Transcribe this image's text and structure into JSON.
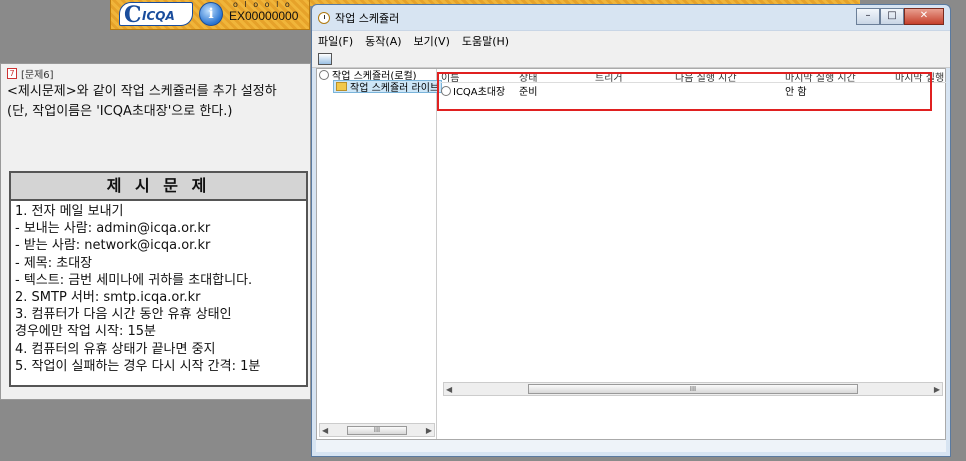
{
  "banner": {
    "logo_text": "ICQA",
    "info_glyph": "i",
    "exam_dots": "o l o o l o",
    "exam_code": "EX00000000"
  },
  "question": {
    "title": "[문제6]",
    "line1": "<제시문제>와 같이 작업 스케쥴러를 추가 설정하",
    "line2": "(단, 작업이름은 'ICQA초대장'으로 한다.)",
    "box_title": "제 시 문 제",
    "items": [
      "1. 전자 메일 보내기",
      "  - 보내는 사람: admin@icqa.or.kr",
      "  - 받는 사람: network@icqa.or.kr",
      "  - 제목: 초대장",
      "  - 텍스트: 금번 세미나에 귀하를 초대합니다.",
      "2. SMTP 서버: smtp.icqa.or.kr",
      "3. 컴퓨터가 다음 시간 동안 유휴 상태인",
      "    경우에만 작업 시작: 15분",
      "4. 컴퓨터의 유휴 상태가 끝나면 중지",
      "5. 작업이 실패하는 경우 다시 시작 간격: 1분"
    ]
  },
  "window": {
    "title": "작업 스케쥴러",
    "min_glyph": "–",
    "max_glyph": "□",
    "close_glyph": "✕",
    "menu": [
      "파일(F)",
      "동작(A)",
      "보기(V)",
      "도움말(H)"
    ]
  },
  "tree": {
    "root": "작업 스케쥴러(로컬)",
    "library": "작업 스케쥴러 라이브"
  },
  "list": {
    "headers": [
      "이름",
      "상태",
      "트리거",
      "다음 실행 시간",
      "마지막 실행 시간",
      "마지막 실행"
    ],
    "rows": [
      {
        "name": "ICQA초대장",
        "status": "준비",
        "trigger": "",
        "next_run": "",
        "last_run": "안 함",
        "last_result": ""
      }
    ]
  },
  "scroll": {
    "left_arrow": "◀",
    "right_arrow": "▶",
    "grip": "III"
  }
}
